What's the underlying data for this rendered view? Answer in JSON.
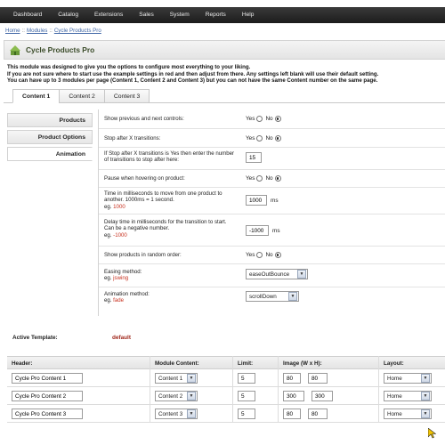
{
  "nav": {
    "items": [
      "Dashboard",
      "Catalog",
      "Extensions",
      "Sales",
      "System",
      "Reports",
      "Help"
    ]
  },
  "breadcrumb": {
    "items": [
      "Home",
      "Modules",
      "Cycle Products Pro"
    ],
    "separator": "::"
  },
  "panel": {
    "title": "Cycle Products Pro",
    "icon": "module-icon"
  },
  "intro": {
    "line1": "This module was designed to give you the options to configure most everything to your liking.",
    "line2": "If you are not sure where to start use the example settings in red and then adjust from there. Any settings left blank will use their default setting.",
    "line3": "You can have up to 3 modules per page (Content 1, Content 2 and Content 3) but you can not have the same Content number on the same page."
  },
  "tabs": [
    "Content 1",
    "Content 2",
    "Content 3"
  ],
  "active_tab": "Content 1",
  "sidemenu": [
    "Products",
    "Product Options",
    "Animation"
  ],
  "active_side": "Animation",
  "radio_labels": {
    "yes": "Yes",
    "no": "No"
  },
  "form": {
    "prev_next": {
      "label": "Show previous and next controls:",
      "value": "No"
    },
    "stop_after": {
      "label": "Stop after X transitions:",
      "value": "No"
    },
    "stop_count": {
      "label": "If Stop after X transitions is Yes then enter the number of transitions to stop after here:",
      "value": "15"
    },
    "pause_hover": {
      "label": "Pause when hovering on product:",
      "value": "No"
    },
    "time_move": {
      "label": "Time in milliseconds to move from one product to another. 1000ms = 1 second.",
      "eg_prefix": "eg. ",
      "eg": "1000",
      "value": "1000",
      "unit": "ms"
    },
    "delay": {
      "label": "Delay time in milliseconds for the transition to start. Can be a negative number.",
      "eg_prefix": "eg. ",
      "eg": "-1000",
      "value": "-1000",
      "unit": "ms"
    },
    "random": {
      "label": "Show products in random order:",
      "value": "No"
    },
    "easing": {
      "label": "Easing method:",
      "eg_prefix": "eg. ",
      "eg": "jswing",
      "value": "easeOutBounce"
    },
    "animation": {
      "label": "Animation method:",
      "eg_prefix": "eg. ",
      "eg": "fade",
      "value": "scrollDown"
    }
  },
  "active_template": {
    "label": "Active Template:",
    "value": "default"
  },
  "module_table": {
    "headers": [
      "Header:",
      "Module Content:",
      "Limit:",
      "Image (W x H):",
      "Layout:"
    ],
    "rows": [
      {
        "header": "Cycle Pro Content 1",
        "content": "Content 1",
        "limit": "5",
        "width": "80",
        "height": "80",
        "layout": "Home"
      },
      {
        "header": "Cycle Pro Content 2",
        "content": "Content 2",
        "limit": "5",
        "width": "300",
        "height": "300",
        "layout": "Home"
      },
      {
        "header": "Cycle Pro Content 3",
        "content": "Content 3",
        "limit": "5",
        "width": "80",
        "height": "80",
        "layout": "Home"
      }
    ]
  },
  "colors": {
    "nav_bg": "#2a2a2a",
    "example_red": "#c8301e",
    "template_red": "#a0271b",
    "link_blue": "#3f66a5"
  }
}
